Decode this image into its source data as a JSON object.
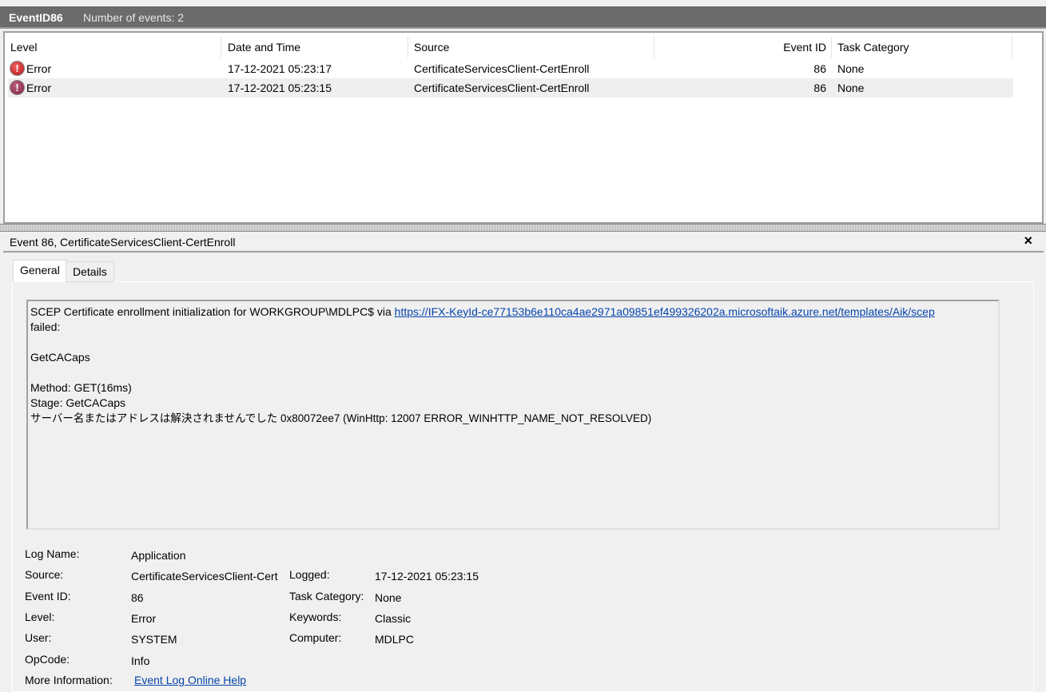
{
  "topbar": {
    "title": "EventID86",
    "count": "Number of events: 2"
  },
  "list": {
    "columns": [
      "Level",
      "Date and Time",
      "Source",
      "Event ID",
      "Task Category"
    ],
    "rows": [
      {
        "level": "Error",
        "datetime": "17-12-2021 05:23:17",
        "source": "CertificateServicesClient-CertEnroll",
        "event_id": "86",
        "task": "None"
      },
      {
        "level": "Error",
        "datetime": "17-12-2021 05:23:15",
        "source": "CertificateServicesClient-CertEnroll",
        "event_id": "86",
        "task": "None"
      }
    ]
  },
  "detail": {
    "title": "Event 86, CertificateServicesClient-CertEnroll",
    "close": "×",
    "tabs": [
      "General",
      "Details"
    ],
    "message": {
      "line1": "SCEP Certificate enrollment initialization for WORKGROUP\\MDLPC$ via ",
      "link": "https://IFX-KeyId-ce77153b6e110ca4ae2971a09851ef499326202a.microsoftaik.azure.net/templates/Aik/scep",
      "line2": "failed:",
      "line3": "GetCACaps",
      "line4": "Method: GET(16ms)",
      "line5": "Stage: GetCACaps",
      "line6": "サーバー名またはアドレスは解決されませんでした 0x80072ee7 (WinHttp: 12007 ERROR_WINHTTP_NAME_NOT_RESOLVED)"
    },
    "fields": {
      "log_name_label": "Log Name:",
      "log_name": "Application",
      "source_label": "Source:",
      "source": "CertificateServicesClient-Cert",
      "logged_label": "Logged:",
      "logged": "17-12-2021 05:23:15",
      "event_id_label": "Event ID:",
      "event_id": "86",
      "task_label": "Task Category:",
      "task": "None",
      "level_label": "Level:",
      "level": "Error",
      "keywords_label": "Keywords:",
      "keywords": "Classic",
      "user_label": "User:",
      "user": "SYSTEM",
      "computer_label": "Computer:",
      "computer": "MDLPC",
      "opcode_label": "OpCode:",
      "opcode": "Info",
      "more_label": "More Information:",
      "more_link": "Event Log Online Help"
    }
  }
}
